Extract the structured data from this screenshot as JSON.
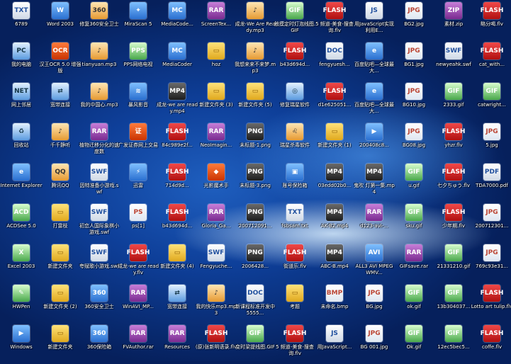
{
  "columns": [
    [
      {
        "label": "6789",
        "icon": "text-icon",
        "glyph": "TXT",
        "type": "doc"
      },
      {
        "label": "我的电脑",
        "icon": "computer-icon",
        "glyph": "PC",
        "type": "sys"
      },
      {
        "label": "网上邻居",
        "icon": "network-icon",
        "glyph": "NET",
        "type": "sys"
      },
      {
        "label": "回收站",
        "icon": "recycle-bin-icon",
        "glyph": "♻",
        "type": "sys"
      },
      {
        "label": "Internet Explorer",
        "icon": "ie-icon",
        "glyph": "e",
        "type": "app"
      },
      {
        "label": "ACDSee 5.0",
        "icon": "acdsee-icon",
        "glyph": "ACD",
        "type": "gif"
      },
      {
        "label": "Excel 2003",
        "icon": "excel-icon",
        "glyph": "X",
        "type": "gif"
      },
      {
        "label": "HWPen",
        "icon": "hwpen-icon",
        "glyph": "✎",
        "type": "gif"
      },
      {
        "label": "Windows",
        "icon": "windows-icon",
        "glyph": "▶",
        "type": "app"
      }
    ],
    [
      {
        "label": "Word 2003",
        "icon": "word-icon",
        "glyph": "W",
        "type": "app"
      },
      {
        "label": "汉王OCR 5.0 增强版",
        "icon": "ocr-icon",
        "glyph": "OCR",
        "type": "red"
      },
      {
        "label": "宽带连接",
        "icon": "broadband-icon",
        "glyph": "⇄",
        "type": "sys"
      },
      {
        "label": "千千静听",
        "icon": "ttplayer-icon",
        "glyph": "♪",
        "type": "qq"
      },
      {
        "label": "腾讯QQ",
        "icon": "qq-icon",
        "glyph": "QQ",
        "type": "qq"
      },
      {
        "label": "打雷枝",
        "icon": "folder-icon",
        "glyph": "▭",
        "type": "folder"
      },
      {
        "label": "新建文件夹",
        "icon": "folder-icon",
        "glyph": "▭",
        "type": "folder"
      },
      {
        "label": "新建文件夹 (2)",
        "icon": "folder-icon",
        "glyph": "▭",
        "type": "folder"
      },
      {
        "label": "新建文件夹",
        "icon": "folder-icon",
        "glyph": "▭",
        "type": "folder"
      }
    ],
    [
      {
        "label": "修复360安全卫士",
        "icon": "shield-icon",
        "glyph": "360",
        "type": "qq"
      },
      {
        "label": "tianyuan.mp3",
        "icon": "audio-icon",
        "glyph": "♪",
        "type": "qq"
      },
      {
        "label": "我的中国心.mp3",
        "icon": "audio-icon",
        "glyph": "♪",
        "type": "qq"
      },
      {
        "label": "植物迁移分化的速度数",
        "icon": "rar-icon",
        "glyph": "RAR",
        "type": "rar"
      },
      {
        "label": "因特准备小游戏.swf",
        "icon": "swf-icon",
        "glyph": "SWF",
        "type": "doc"
      },
      {
        "label": "初恋人国际象棋小游戏.swf",
        "icon": "swf-icon",
        "glyph": "SWF",
        "type": "doc"
      },
      {
        "label": "夸赋歌小游戏.swf",
        "icon": "swf-icon",
        "glyph": "SWF",
        "type": "doc"
      },
      {
        "label": "360安全卫士",
        "icon": "shield-icon",
        "glyph": "360",
        "type": "app"
      },
      {
        "label": "360保险箱",
        "icon": "shield-icon",
        "glyph": "360",
        "type": "app"
      }
    ],
    [
      {
        "label": "MiraScan 5",
        "icon": "scanner-icon",
        "glyph": "✦",
        "type": "app"
      },
      {
        "label": "PPS网络电视",
        "icon": "pps-icon",
        "glyph": "PPS",
        "type": "gif"
      },
      {
        "label": "暴风影音",
        "icon": "storm-icon",
        "glyph": "≋",
        "type": "app"
      },
      {
        "label": "广发证券网上交易",
        "icon": "stock-icon",
        "glyph": "证",
        "type": "red"
      },
      {
        "label": "迅雷",
        "icon": "thunder-icon",
        "glyph": "⚡",
        "type": "app"
      },
      {
        "label": "ps[1]",
        "icon": "image-icon",
        "glyph": "PS",
        "type": "img"
      },
      {
        "label": "成龙-we are ready.flv",
        "icon": "flash-icon",
        "glyph": "FLASH",
        "type": "flash"
      },
      {
        "label": "WinAVI_MP...",
        "icon": "rar-icon",
        "glyph": "RAR",
        "type": "rar"
      },
      {
        "label": "FVAuthor.rar",
        "icon": "rar-icon",
        "glyph": "RAR",
        "type": "rar"
      }
    ],
    [
      {
        "label": "MediaCode...",
        "icon": "media-icon",
        "glyph": "MC",
        "type": "app"
      },
      {
        "label": "MediaCoder",
        "icon": "media-icon",
        "glyph": "MC",
        "type": "app"
      },
      {
        "label": "成龙-we are ready.mp4",
        "icon": "mp4-icon",
        "glyph": "MP4",
        "type": "mp4"
      },
      {
        "label": "84c989e2f...",
        "icon": "flash-icon",
        "glyph": "FLASH",
        "type": "flash"
      },
      {
        "label": "714d9d... ",
        "icon": "flash-icon",
        "glyph": "FLASH",
        "type": "flash"
      },
      {
        "label": "b43d694d...",
        "icon": "flash-icon",
        "glyph": "FLASH",
        "type": "flash"
      },
      {
        "label": "新建文件夹 (4)",
        "icon": "folder-icon",
        "glyph": "▭",
        "type": "folder"
      },
      {
        "label": "宽带连接",
        "icon": "broadband-icon",
        "glyph": "⇄",
        "type": "sys"
      },
      {
        "label": "Resources",
        "icon": "rar-icon",
        "glyph": "RAR",
        "type": "rar"
      }
    ],
    [
      {
        "label": "ScreenTex...",
        "icon": "rar-icon",
        "glyph": "RAR",
        "type": "rar"
      },
      {
        "label": "hoz",
        "icon": "folder-icon",
        "glyph": "▭",
        "type": "folder"
      },
      {
        "label": "新建文件夹 (3)",
        "icon": "folder-icon",
        "glyph": "▭",
        "type": "folder"
      },
      {
        "label": "NeoImagin...",
        "icon": "rar-icon",
        "glyph": "RAR",
        "type": "rar"
      },
      {
        "label": "光影魔术手",
        "icon": "nmagic-icon",
        "glyph": "◆",
        "type": "red"
      },
      {
        "label": "Gloria_Ga...",
        "icon": "rar-icon",
        "glyph": "RAR",
        "type": "rar"
      },
      {
        "label": "Fengyuche...",
        "icon": "swf-icon",
        "glyph": "SWF",
        "type": "doc"
      },
      {
        "label": "我的快乐mp3.mp3",
        "icon": "audio-icon",
        "glyph": "♪",
        "type": "qq"
      },
      {
        "label": "(原)张新明语录.flv",
        "icon": "flash-icon",
        "glyph": "FLASH",
        "type": "flash"
      }
    ],
    [
      {
        "label": "成龙-We Are Ready.mp3",
        "icon": "audio-icon",
        "glyph": "♪",
        "type": "qq"
      },
      {
        "label": "我想来来不来梦.mp3",
        "icon": "audio-icon",
        "glyph": "♪",
        "type": "qq"
      },
      {
        "label": "新建文件夹 (5)",
        "icon": "folder-icon",
        "glyph": "▭",
        "type": "folder"
      },
      {
        "label": "未标题-1.png",
        "icon": "png-icon",
        "glyph": "PNG",
        "type": "mp4"
      },
      {
        "label": "未标题-3.png",
        "icon": "png-icon",
        "glyph": "PNG",
        "type": "mp4"
      },
      {
        "label": "200712091...",
        "icon": "png-icon",
        "glyph": "PNG",
        "type": "mp4"
      },
      {
        "label": "2006428...",
        "icon": "png-icon",
        "glyph": "PNG",
        "type": "mp4"
      },
      {
        "label": "新课程标准开发中5555...",
        "icon": "doc-icon",
        "glyph": "DOC",
        "type": "doc"
      },
      {
        "label": "变时梁提线图.GIF",
        "icon": "gif-icon",
        "glyph": "GIF",
        "type": "gif"
      }
    ],
    [
      {
        "label": "触摸定时灯泡线图.GIF",
        "icon": "gif-icon",
        "glyph": "GIF",
        "type": "gif"
      },
      {
        "label": "b43d694d...",
        "icon": "flash-icon",
        "glyph": "FLASH",
        "type": "flash"
      },
      {
        "label": "修复瑞星软件",
        "icon": "rising-icon",
        "glyph": "◎",
        "type": "sys"
      },
      {
        "label": "瑞星杀毒软件",
        "icon": "lion-icon",
        "glyph": "♌",
        "type": "qq"
      },
      {
        "label": "账号保险箱",
        "icon": "lock-icon",
        "glyph": "▣",
        "type": "app"
      },
      {
        "label": "fsbsam.txt",
        "icon": "text-icon",
        "glyph": "TXT",
        "type": "doc"
      },
      {
        "label": "街道乐.flv",
        "icon": "flash-icon",
        "glyph": "FLASH",
        "type": "flash"
      },
      {
        "label": "考题",
        "icon": "folder-icon",
        "glyph": "▭",
        "type": "folder"
      },
      {
        "label": "5 频道-美食-搜查询.flv",
        "icon": "flash-icon",
        "glyph": "FLASH",
        "type": "flash"
      }
    ],
    [
      {
        "label": "5 频道-美食-搜查询.flv",
        "icon": "flash-icon",
        "glyph": "FLASH",
        "type": "flash"
      },
      {
        "label": "fengyuesh...",
        "icon": "doc-icon",
        "glyph": "DOC",
        "type": "doc"
      },
      {
        "label": "d1e625051...",
        "icon": "flash-icon",
        "glyph": "FLASH",
        "type": "flash"
      },
      {
        "label": "新建文件夹 (1)",
        "icon": "folder-icon",
        "glyph": "▭",
        "type": "folder"
      },
      {
        "label": "03edd02b0...",
        "icon": "mp4-icon",
        "glyph": "MP4",
        "type": "mp4"
      },
      {
        "label": "AK-B2.mp4",
        "icon": "mp4-icon",
        "glyph": "MP4",
        "type": "mp4"
      },
      {
        "label": "ABC-B.mp4",
        "icon": "mp4-icon",
        "glyph": "MP4",
        "type": "mp4"
      },
      {
        "label": "未命名.bmp",
        "icon": "bmp-icon",
        "glyph": "BMP",
        "type": "img"
      },
      {
        "label": "用JavaScript...",
        "icon": "doc-icon",
        "glyph": "JS",
        "type": "doc"
      }
    ],
    [
      {
        "label": "用JavaScript实现利用E...",
        "icon": "doc-icon",
        "glyph": "JS",
        "type": "doc"
      },
      {
        "label": "百度贴吧—全球最大...",
        "icon": "ie-icon",
        "glyph": "e",
        "type": "app"
      },
      {
        "label": "百度贴吧—全球最大...",
        "icon": "ie-icon",
        "glyph": "e",
        "type": "app"
      },
      {
        "label": "200408c8...",
        "icon": "wmp-icon",
        "glyph": "▶",
        "type": "app"
      },
      {
        "label": "鬼吹 灯第一集.mp4",
        "icon": "mp4-icon",
        "glyph": "MP4",
        "type": "mp4"
      },
      {
        "label": "d123-avi-...",
        "icon": "rar-icon",
        "glyph": "RAR",
        "type": "rar"
      },
      {
        "label": "ALL3 AVI MPEG WMV...",
        "icon": "media-icon",
        "glyph": "AVI",
        "type": "app"
      },
      {
        "label": "BG.jpg",
        "icon": "jpg-icon",
        "glyph": "JPG",
        "type": "img"
      },
      {
        "label": "BG 001.jpg",
        "icon": "jpg-icon",
        "glyph": "JPG",
        "type": "img"
      }
    ],
    [
      {
        "label": "BG2.jpg",
        "icon": "jpg-icon",
        "glyph": "JPG",
        "type": "img"
      },
      {
        "label": "BG1.jpg",
        "icon": "jpg-icon",
        "glyph": "JPG",
        "type": "img"
      },
      {
        "label": "BG10.jpg",
        "icon": "jpg-icon",
        "glyph": "JPG",
        "type": "img"
      },
      {
        "label": "BG08.jpg",
        "icon": "jpg-icon",
        "glyph": "JPG",
        "type": "img"
      },
      {
        "label": "u.gif",
        "icon": "gif-icon",
        "glyph": "GIF",
        "type": "gif"
      },
      {
        "label": "sku.gif",
        "icon": "gif-icon",
        "glyph": "GIF",
        "type": "gif"
      },
      {
        "label": "GIFsave.rar",
        "icon": "rar-icon",
        "glyph": "RAR",
        "type": "rar"
      },
      {
        "label": "ok.gif",
        "icon": "gif-icon",
        "glyph": "GIF",
        "type": "gif"
      },
      {
        "label": "Ok.gif",
        "icon": "gif-icon",
        "glyph": "GIF",
        "type": "gif"
      }
    ],
    [
      {
        "label": "素材.zip",
        "icon": "rar-icon",
        "glyph": "ZIP",
        "type": "rar"
      },
      {
        "label": "newyeahk.swf",
        "icon": "swf-icon",
        "glyph": "SWF",
        "type": "doc"
      },
      {
        "label": "2333.gif",
        "icon": "gif-icon",
        "glyph": "GIF",
        "type": "gif"
      },
      {
        "label": "yhzr.flv",
        "icon": "flash-icon",
        "glyph": "FLASH",
        "type": "flash"
      },
      {
        "label": "七夕ちゅう.flv",
        "icon": "flash-icon",
        "glyph": "FLASH",
        "type": "flash"
      },
      {
        "label": "少年期.flv",
        "icon": "flash-icon",
        "glyph": "FLASH",
        "type": "flash"
      },
      {
        "label": "21331210.gif",
        "icon": "gif-icon",
        "glyph": "GIF",
        "type": "gif"
      },
      {
        "label": "13b304037...",
        "icon": "gif-icon",
        "glyph": "GIF",
        "type": "gif"
      },
      {
        "label": "12ec5bec5...",
        "icon": "gif-icon",
        "glyph": "GIF",
        "type": "gif"
      }
    ],
    [
      {
        "label": "略分喝.flv",
        "icon": "flash-icon",
        "glyph": "FLASH",
        "type": "flash"
      },
      {
        "label": "cat_with...",
        "icon": "flash-icon",
        "glyph": "FLASH",
        "type": "flash"
      },
      {
        "label": "catwright...",
        "icon": "gif-icon",
        "glyph": "GIF",
        "type": "gif"
      },
      {
        "label": "5.jpg",
        "icon": "jpg-icon",
        "glyph": "JPG",
        "type": "img"
      },
      {
        "label": "TDA7000.pdf",
        "icon": "pdf-icon",
        "glyph": "PDF",
        "type": "doc"
      },
      {
        "label": "200712301...",
        "icon": "jpg-icon",
        "glyph": "JPG",
        "type": "img"
      },
      {
        "label": "769c93e31...",
        "icon": "jpg-icon",
        "glyph": "JPG",
        "type": "img"
      },
      {
        "label": "Lotto art tulip.flv",
        "icon": "flash-icon",
        "glyph": "FLASH",
        "type": "flash"
      },
      {
        "label": "coffe.flv",
        "icon": "flash-icon",
        "glyph": "FLASH",
        "type": "flash"
      }
    ]
  ]
}
